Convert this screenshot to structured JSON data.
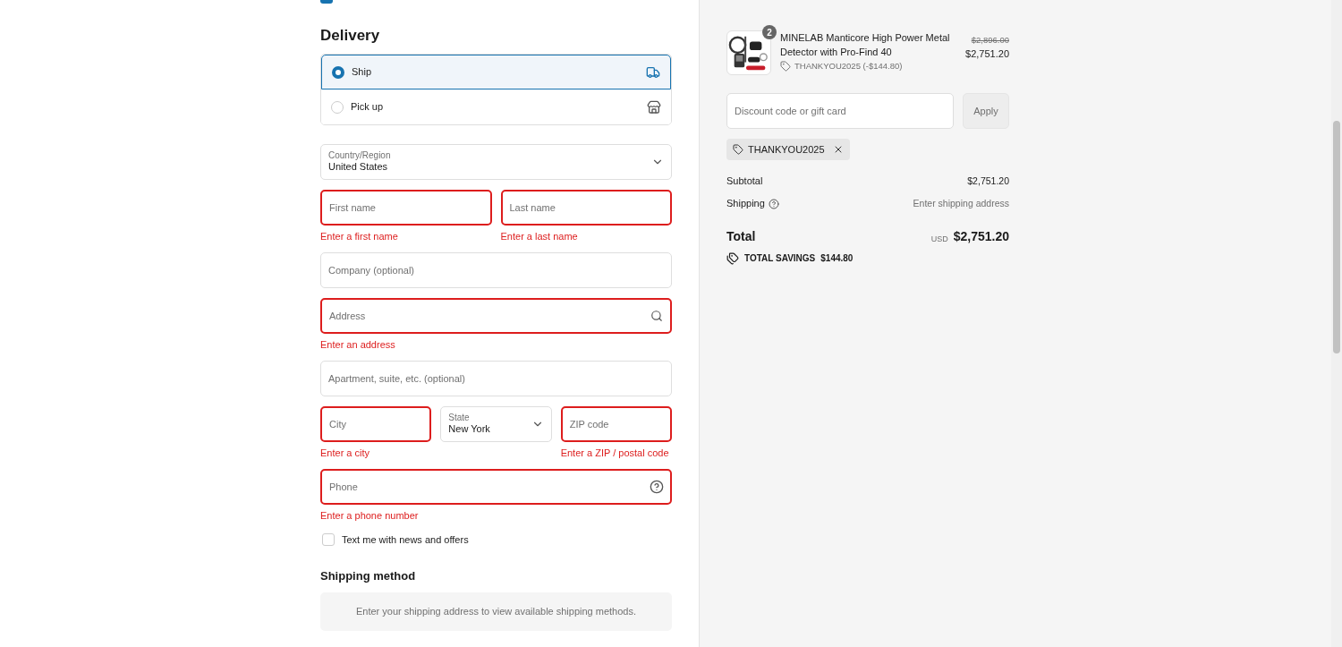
{
  "email_checkbox": {
    "checked": true
  },
  "delivery": {
    "title": "Delivery",
    "options": [
      {
        "kind": "ship",
        "label": "Ship",
        "selected": true
      },
      {
        "kind": "pickup",
        "label": "Pick up",
        "selected": false
      }
    ]
  },
  "address_rows": [
    [
      {
        "kind": "select",
        "label": "Country/Region",
        "value": "United States"
      }
    ],
    [
      {
        "kind": "input",
        "placeholder": "First name",
        "error": "Enter a first name"
      },
      {
        "kind": "input",
        "placeholder": "Last name",
        "error": "Enter a last name"
      }
    ],
    [
      {
        "kind": "input",
        "placeholder": "Company (optional)"
      }
    ],
    [
      {
        "kind": "search",
        "placeholder": "Address",
        "error": "Enter an address"
      }
    ],
    [
      {
        "kind": "input",
        "placeholder": "Apartment, suite, etc. (optional)"
      }
    ],
    [
      {
        "kind": "input",
        "placeholder": "City",
        "error": "Enter a city"
      },
      {
        "kind": "select",
        "label": "State",
        "value": "New York"
      },
      {
        "kind": "input",
        "placeholder": "ZIP code",
        "error": "Enter a ZIP / postal code"
      }
    ],
    [
      {
        "kind": "help",
        "placeholder": "Phone",
        "error": "Enter a phone number"
      }
    ]
  ],
  "sms_checkbox": {
    "label": "Text me with news and offers",
    "checked": false
  },
  "shipping_method": {
    "title": "Shipping method",
    "message": "Enter your shipping address to view available shipping methods."
  },
  "summary": {
    "item": {
      "quantity": "2",
      "name": "MINELAB Manticore High Power Metal Detector with Pro-Find 40",
      "discount": "THANKYOU2025 (-$144.80)",
      "original_price": "$2,896.00",
      "price": "$2,751.20"
    },
    "discount_field": {
      "placeholder": "Discount code or gift card"
    },
    "apply_button": "Apply",
    "applied_code": "THANKYOU2025",
    "lines": [
      {
        "kind": "amount",
        "label": "Subtotal",
        "value": "$2,751.20"
      },
      {
        "kind": "pending",
        "label": "Shipping",
        "value": "Enter shipping address"
      }
    ],
    "total": {
      "label": "Total",
      "currency": "USD",
      "value": "$2,751.20"
    },
    "savings": {
      "label": "TOTAL SAVINGS",
      "value": "$144.80"
    }
  }
}
